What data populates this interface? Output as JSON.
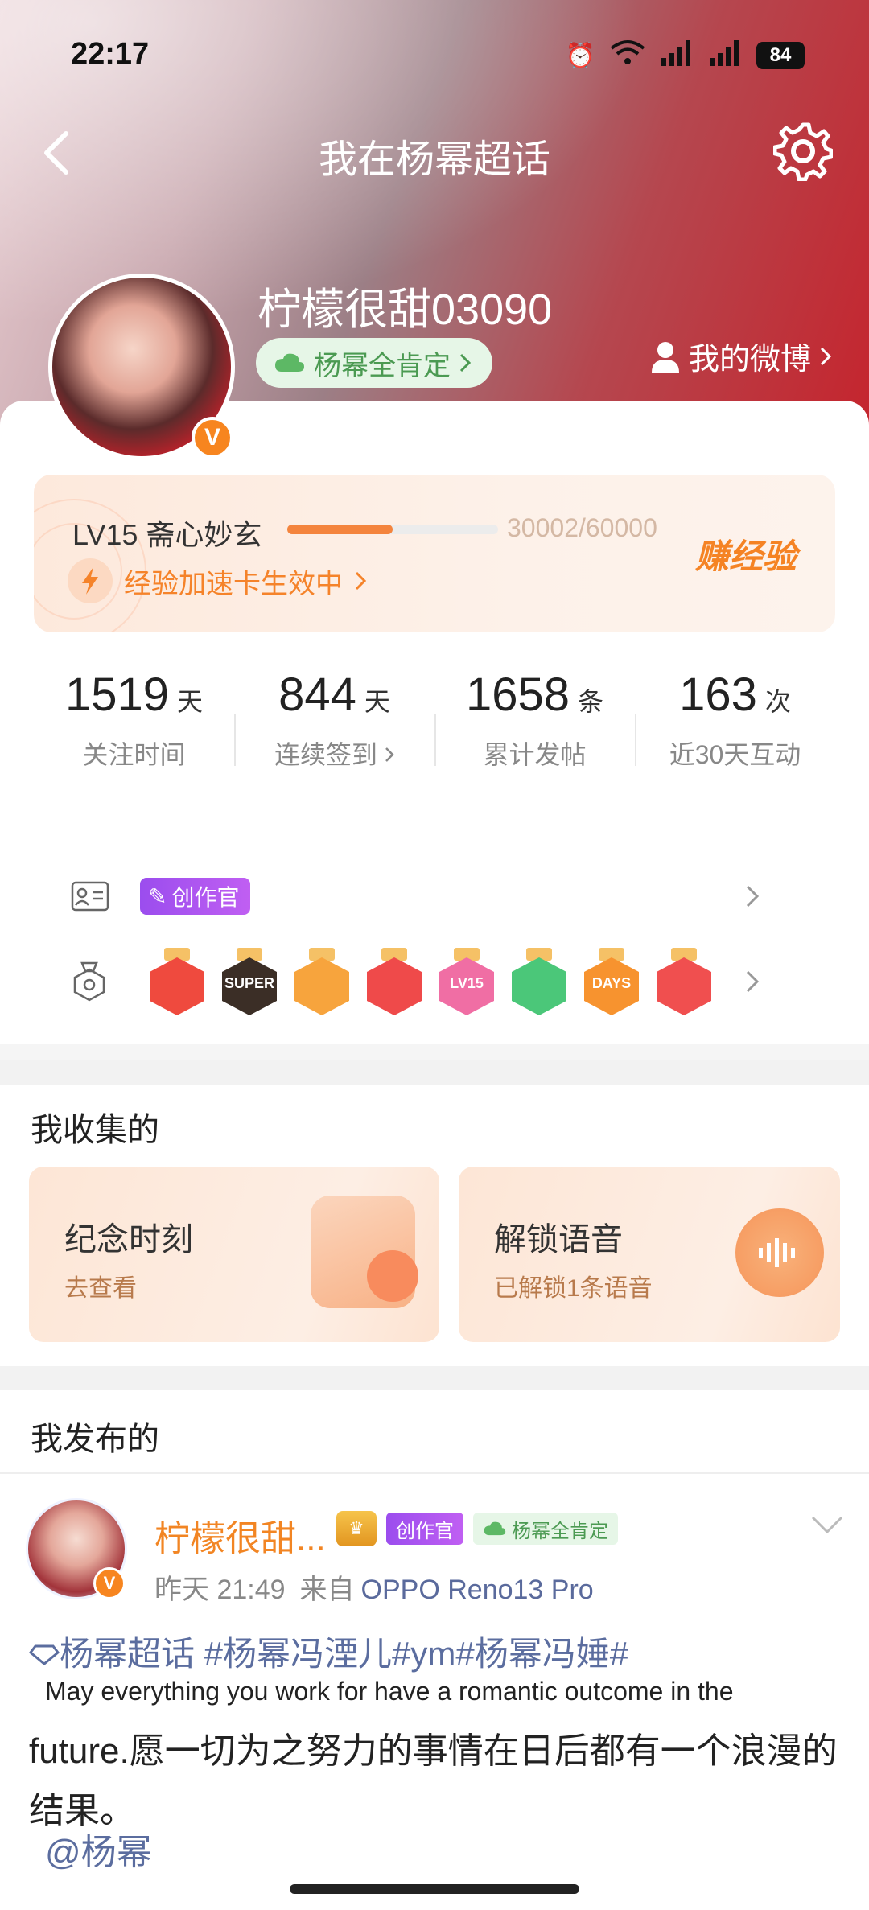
{
  "status_bar": {
    "time": "22:17",
    "battery": "84"
  },
  "nav": {
    "title": "我在杨幂超话"
  },
  "profile": {
    "username": "柠檬很甜03090",
    "fan_tag": "杨幂全肯定",
    "my_weibo": "我的微博",
    "verified_mark": "V"
  },
  "level": {
    "title": "LV15 斋心妙玄",
    "progress_text": "30002/60000",
    "progress_fraction": 0.5,
    "earn_label": "赚经验",
    "boost_label": "经验加速卡生效中"
  },
  "stats": [
    {
      "value": "1519",
      "unit": "天",
      "label": "关注时间"
    },
    {
      "value": "844",
      "unit": "天",
      "label": "连续签到"
    },
    {
      "value": "1658",
      "unit": "条",
      "label": "累计发帖"
    },
    {
      "value": "163",
      "unit": "次",
      "label": "近30天互动"
    }
  ],
  "badges": {
    "creator_label": "创作官",
    "medals": [
      {
        "icon": "cartoon-medal",
        "text": "",
        "color": "#ef4a3e"
      },
      {
        "icon": "super-crown-medal",
        "text": "SUPER",
        "color": "#3b2e26"
      },
      {
        "icon": "crown-medal",
        "text": "",
        "color": "#f7a43d"
      },
      {
        "icon": "character-medal",
        "text": "",
        "color": "#ef4a4a"
      },
      {
        "icon": "lv15-medal",
        "text": "LV15",
        "color": "#f06ea4"
      },
      {
        "icon": "hand-medal",
        "text": "",
        "color": "#4bc779"
      },
      {
        "icon": "100-days-medal",
        "text": "DAYS",
        "color": "#f7932f"
      },
      {
        "icon": "trophy-medal",
        "text": "",
        "color": "#f04f4f"
      }
    ]
  },
  "collected": {
    "title": "我收集的",
    "cards": [
      {
        "title": "纪念时刻",
        "sub": "去查看"
      },
      {
        "title": "解锁语音",
        "sub": "已解锁1条语音"
      }
    ]
  },
  "published": {
    "title": "我发布的",
    "post": {
      "name": "柠檬很甜...",
      "creator_tag": "创作官",
      "fan_tag": "杨幂全肯定",
      "time": "昨天 21:49",
      "source_prefix": "来自",
      "device": "OPPO Reno13 Pro",
      "topics": "杨幂超话 #杨幂冯湮儿#ym#杨幂冯娷#",
      "line_en": "May everything you work for have a romantic outcome in the",
      "body": "future.愿一切为之努力的事情在日后都有一个浪漫的结果。",
      "mention": "@杨幂"
    }
  },
  "colors": {
    "accent": "#f4843d",
    "link": "#5b6d9f",
    "brand_red": "#c5242d"
  }
}
